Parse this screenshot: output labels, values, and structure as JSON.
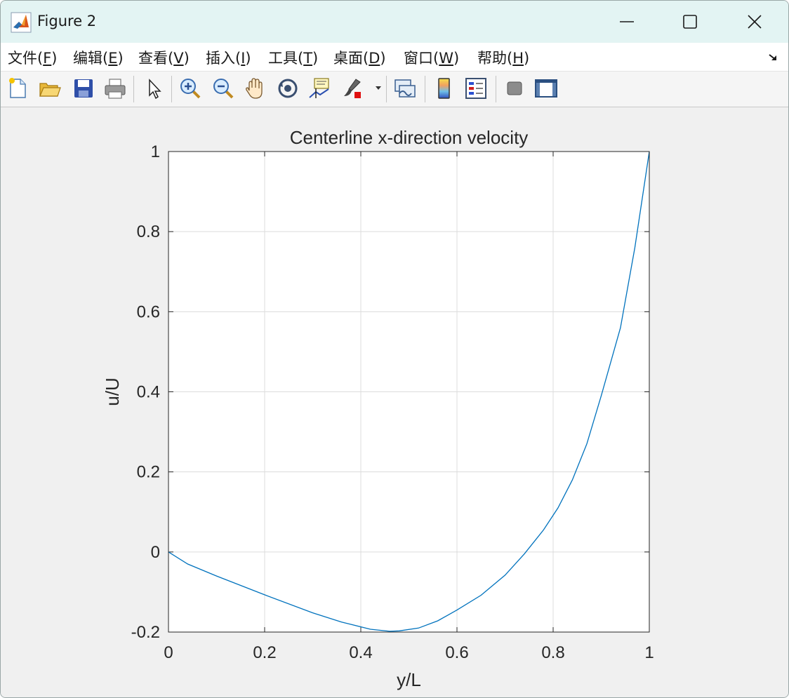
{
  "window": {
    "title": "Figure 2"
  },
  "menu": [
    {
      "pre": "文件(",
      "mn": "F",
      "post": ")"
    },
    {
      "pre": "编辑(",
      "mn": "E",
      "post": ")"
    },
    {
      "pre": "查看(",
      "mn": "V",
      "post": ")"
    },
    {
      "pre": "插入(",
      "mn": "I",
      "post": ")"
    },
    {
      "pre": "工具(",
      "mn": "T",
      "post": ")"
    },
    {
      "pre": "桌面(",
      "mn": "D",
      "post": ")"
    },
    {
      "pre": "窗口(",
      "mn": "W",
      "post": ")"
    },
    {
      "pre": "帮助(",
      "mn": "H",
      "post": ")"
    }
  ],
  "toolbar": {
    "icons": [
      "new-figure-icon",
      "open-file-icon",
      "save-icon",
      "print-icon",
      "select-arrow-icon",
      "zoom-in-icon",
      "zoom-out-icon",
      "pan-hand-icon",
      "rotate-3d-icon",
      "data-cursor-icon",
      "brush-icon",
      "link-plot-icon",
      "insert-colorbar-icon",
      "insert-legend-icon",
      "hide-plot-tools-icon",
      "show-plot-tools-icon"
    ]
  },
  "colors": {
    "line": "#0072bd",
    "grid": "#dcdcdc",
    "titlebar": "#e3f4f3"
  },
  "chart_data": {
    "type": "line",
    "title": "Centerline x-direction velocity",
    "xlabel": "y/L",
    "ylabel": "u/U",
    "xlim": [
      0,
      1
    ],
    "ylim": [
      -0.2,
      1
    ],
    "xticks": [
      "0",
      "0.2",
      "0.4",
      "0.6",
      "0.8",
      "1"
    ],
    "yticks": [
      "-0.2",
      "0",
      "0.2",
      "0.4",
      "0.6",
      "0.8",
      "1"
    ],
    "grid": true,
    "series": [
      {
        "x": [
          0,
          0.04,
          0.1,
          0.2,
          0.3,
          0.36,
          0.42,
          0.46,
          0.48,
          0.52,
          0.56,
          0.6,
          0.65,
          0.7,
          0.74,
          0.78,
          0.81,
          0.84,
          0.87,
          0.9,
          0.94,
          0.97,
          1.0
        ],
        "y": [
          0,
          -0.03,
          -0.06,
          -0.107,
          -0.152,
          -0.175,
          -0.193,
          -0.198,
          -0.197,
          -0.19,
          -0.172,
          -0.145,
          -0.108,
          -0.058,
          -0.005,
          0.055,
          0.11,
          0.18,
          0.27,
          0.39,
          0.56,
          0.76,
          1.0
        ]
      }
    ]
  }
}
